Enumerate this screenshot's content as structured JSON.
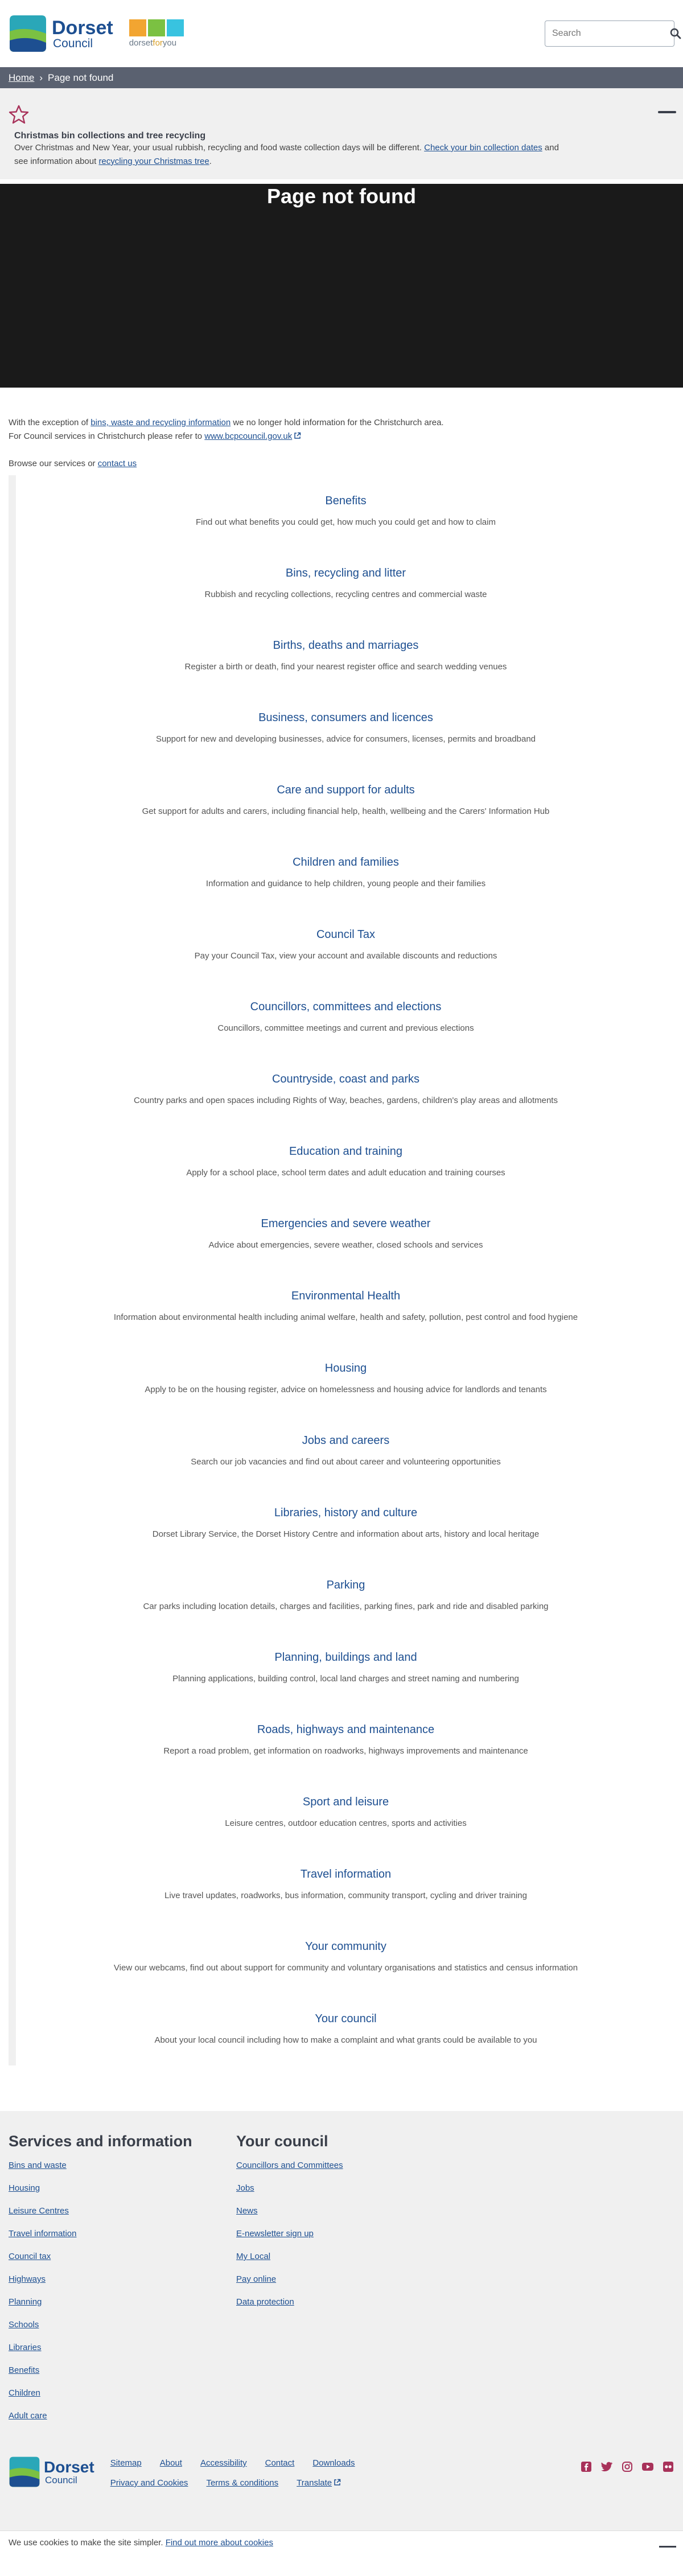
{
  "header": {
    "logo": {
      "line1": "Dorset",
      "line2": "Council"
    },
    "dfy": {
      "prefix": "dorset",
      "mid": "for",
      "suffix": "you"
    },
    "search_placeholder": "Search",
    "colors": {
      "brand": "#1d4f91",
      "dfy_orange": "#f2a531",
      "dfy_green": "#7bc142",
      "dfy_cyan": "#38c3e0"
    }
  },
  "breadcrumb": {
    "home": "Home",
    "sep": "›",
    "current": "Page not found"
  },
  "alert": {
    "title": "Christmas bin collections and tree recycling",
    "line1_text": "Over Christmas and New Year, your usual rubbish, recycling and food waste collection days will be different. ",
    "line1_link": "Check your bin collection dates",
    "line1_after": " and",
    "line2_text": "see information about ",
    "line2_link": "recycling your Christmas tree",
    "line2_after": "."
  },
  "hero": {
    "title": "Page not found"
  },
  "content": {
    "p1_a": "With the exception of ",
    "p1_link": "bins, waste and recycling information",
    "p1_b": " we no longer hold information for the Christchurch area.",
    "p2_a": "For Council services in Christchurch please refer to ",
    "p2_link": "www.bcpcouncil.gov.uk",
    "p3_a": "Browse our services or ",
    "p3_link": "contact us"
  },
  "services": [
    {
      "title": "Benefits",
      "desc": "Find out what benefits you could get, how much you could get and how to claim"
    },
    {
      "title": "Bins, recycling and litter",
      "desc": "Rubbish and recycling collections, recycling centres and commercial waste"
    },
    {
      "title": "Births, deaths and marriages",
      "desc": "Register a birth or death, find your nearest register office and search wedding venues"
    },
    {
      "title": "Business, consumers and licences",
      "desc": "Support for new and developing businesses, advice for consumers, licenses, permits and broadband"
    },
    {
      "title": "Care and support for adults",
      "desc": "Get support for adults and carers, including financial help, health, wellbeing and the Carers' Information Hub"
    },
    {
      "title": "Children and families",
      "desc": "Information and guidance to help children, young people and their families"
    },
    {
      "title": "Council Tax",
      "desc": "Pay your Council Tax, view your account and available discounts and reductions"
    },
    {
      "title": "Councillors, committees and elections",
      "desc": "Councillors, committee meetings and current and previous elections"
    },
    {
      "title": "Countryside, coast and parks",
      "desc": "Country parks and open spaces including Rights of Way, beaches, gardens, children's play areas and allotments"
    },
    {
      "title": "Education and training",
      "desc": "Apply for a school place, school term dates and adult education and training courses"
    },
    {
      "title": "Emergencies and severe weather",
      "desc": "Advice about emergencies, severe weather, closed schools and services"
    },
    {
      "title": "Environmental Health",
      "desc": "Information about environmental health including animal welfare, health and safety, pollution, pest control and food hygiene"
    },
    {
      "title": "Housing",
      "desc": "Apply to be on the housing register, advice on homelessness and housing advice for landlords and tenants"
    },
    {
      "title": "Jobs and careers",
      "desc": "Search our job vacancies and find out about career and volunteering opportunities"
    },
    {
      "title": "Libraries, history and culture",
      "desc": "Dorset Library Service, the Dorset History Centre and information about arts, history and local heritage"
    },
    {
      "title": "Parking",
      "desc": "Car parks including location details, charges and facilities, parking fines, park and ride and disabled parking"
    },
    {
      "title": "Planning, buildings and land",
      "desc": "Planning applications, building control, local land charges and street naming and numbering"
    },
    {
      "title": "Roads, highways and maintenance",
      "desc": "Report a road problem, get information on roadworks, highways improvements and maintenance"
    },
    {
      "title": "Sport and leisure",
      "desc": "Leisure centres, outdoor education centres, sports and activities"
    },
    {
      "title": "Travel information",
      "desc": "Live travel updates, roadworks, bus information, community transport, cycling and driver training"
    },
    {
      "title": "Your community",
      "desc": "View our webcams, find out about support for community and voluntary organisations and statistics and census information"
    },
    {
      "title": "Your council",
      "desc": "About your local council including how to make a complaint and what grants could be available to you"
    }
  ],
  "footer": {
    "col1_title": "Services and information",
    "col1_links": [
      "Bins and waste",
      "Housing",
      "Leisure Centres",
      "Travel information",
      "Council tax",
      "Highways",
      "Planning",
      "Schools",
      "Libraries",
      "Benefits",
      "Children",
      "Adult care"
    ],
    "col2_title": "Your council",
    "col2_links": [
      "Councillors and Committees",
      "Jobs",
      "News",
      "E-newsletter sign up",
      "My Local",
      "Pay online",
      "Data protection"
    ],
    "bottom_links": [
      "Sitemap",
      "About",
      "Accessibility",
      "Contact",
      "Downloads",
      "Privacy and Cookies",
      "Terms & conditions",
      "Translate"
    ],
    "social_icons": [
      "facebook-icon",
      "twitter-icon",
      "instagram-icon",
      "youtube-icon",
      "flickr-icon"
    ],
    "social_color": "#a8325a"
  },
  "cookie": {
    "text": "We use cookies to make the site simpler. ",
    "link": "Find out more about cookies"
  }
}
